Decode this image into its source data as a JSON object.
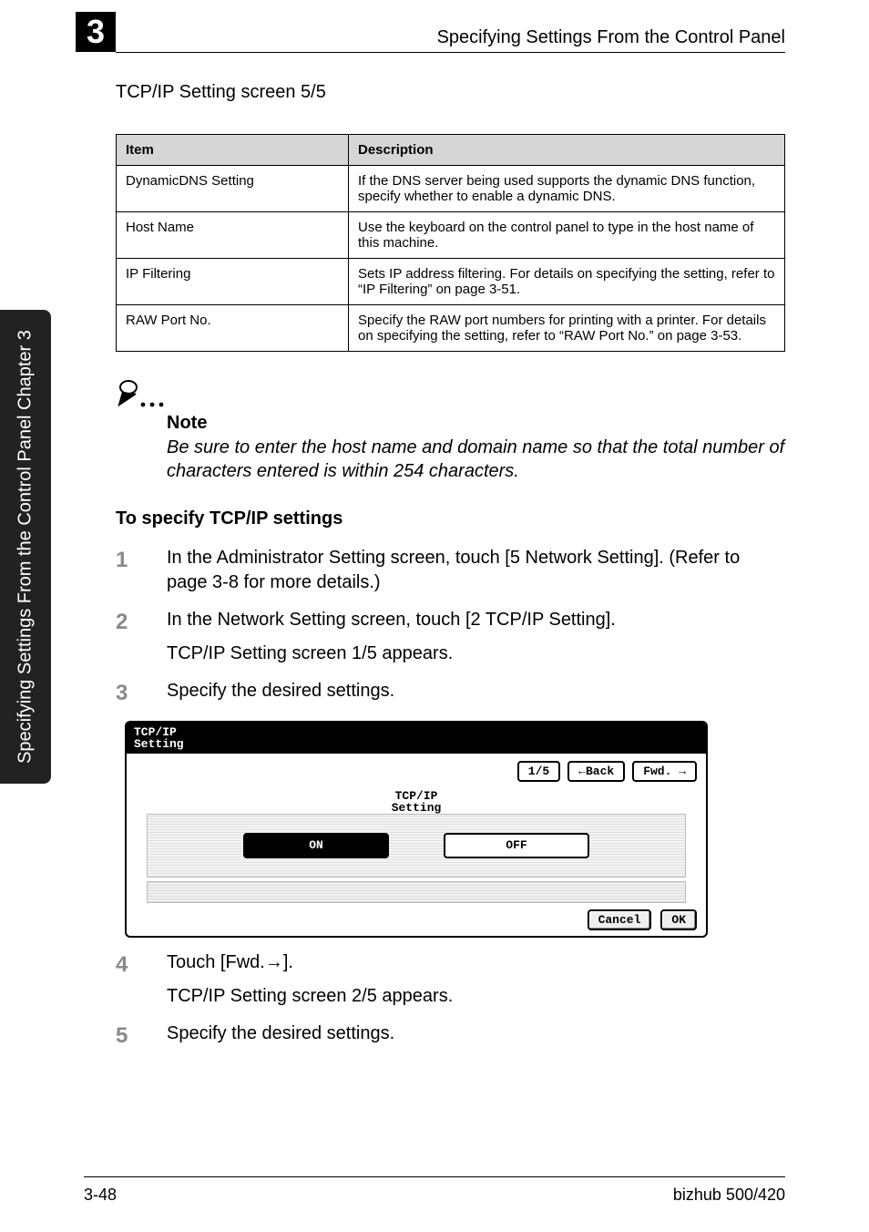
{
  "chapter_number": "3",
  "header_title": "Specifying Settings From the Control Panel",
  "sidebar_label": "Specifying Settings From the Control Panel    Chapter 3",
  "screen_heading": "TCP/IP Setting screen 5/5",
  "table": {
    "headers": [
      "Item",
      "Description"
    ],
    "rows": [
      [
        "DynamicDNS Setting",
        "If the DNS server being used supports the dynamic DNS function, specify whether to enable a dynamic DNS."
      ],
      [
        "Host Name",
        "Use the keyboard on the control panel to type in the host name of this machine."
      ],
      [
        "IP Filtering",
        "Sets IP address filtering. For details on specifying the setting, refer to “IP Filtering” on page 3-51."
      ],
      [
        "RAW Port No.",
        "Specify the RAW port numbers for printing with a printer. For details on specifying the setting, refer to “RAW Port No.” on page 3-53."
      ]
    ]
  },
  "note": {
    "title": "Note",
    "body": "Be sure to enter the host name and domain name so that the total number of characters entered is within 254 characters."
  },
  "section_heading": "To specify TCP/IP settings",
  "steps": [
    {
      "num": "1",
      "text": "In the Administrator Setting screen, touch [5 Network Setting]. (Refer to page 3-8 for more details.)"
    },
    {
      "num": "2",
      "text": "In the Network Setting screen, touch [2 TCP/IP Setting].",
      "sub": "TCP/IP Setting screen 1/5 appears."
    },
    {
      "num": "3",
      "text": "Specify the desired settings."
    },
    {
      "num": "4",
      "text": "Touch [Fwd.→].",
      "sub": "TCP/IP Setting screen 2/5 appears."
    },
    {
      "num": "5",
      "text": "Specify the desired settings."
    }
  ],
  "panel": {
    "title": "TCP/IP\nSetting",
    "page": "1/5",
    "back": "←Back",
    "fwd": "Fwd. →",
    "label": "TCP/IP\nSetting",
    "on": "ON",
    "off": "OFF",
    "cancel": "Cancel",
    "ok": "OK"
  },
  "footer": {
    "left": "3-48",
    "right": "bizhub 500/420"
  }
}
